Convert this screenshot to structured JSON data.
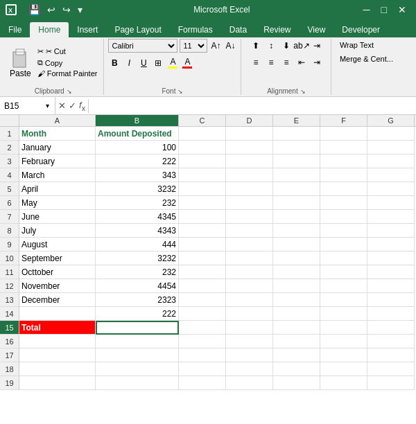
{
  "titleBar": {
    "title": "Microsoft Excel",
    "saveLabel": "💾",
    "undoLabel": "↩",
    "redoLabel": "↪"
  },
  "ribbonTabs": [
    "File",
    "Home",
    "Insert",
    "Page Layout",
    "Formulas",
    "Data",
    "Review",
    "View",
    "Developer"
  ],
  "activeTab": "Home",
  "clipboard": {
    "pasteLabel": "Paste",
    "cutLabel": "✂ Cut",
    "copyLabel": "📋 Copy",
    "formatPainterLabel": "🖌 Format Painter",
    "groupLabel": "Clipboard"
  },
  "font": {
    "name": "Calibri",
    "size": "11",
    "groupLabel": "Font",
    "boldLabel": "B",
    "italicLabel": "I",
    "underlineLabel": "U",
    "fillColor": "#FFFF00",
    "fontColor": "#FF0000"
  },
  "alignment": {
    "groupLabel": "Alignment",
    "wrapText": "Wrap Text",
    "mergeCenterLabel": "Merge & Cent..."
  },
  "formulaBar": {
    "nameBox": "B15",
    "formula": ""
  },
  "columns": [
    "A",
    "B",
    "C",
    "D",
    "E",
    "F",
    "G"
  ],
  "rows": [
    {
      "num": 1,
      "a": "Month",
      "b": "Amount Deposited",
      "isHeader": true
    },
    {
      "num": 2,
      "a": "January",
      "b": "100"
    },
    {
      "num": 3,
      "a": "February",
      "b": "222"
    },
    {
      "num": 4,
      "a": "March",
      "b": "343"
    },
    {
      "num": 5,
      "a": "April",
      "b": "3232"
    },
    {
      "num": 6,
      "a": "May",
      "b": "232"
    },
    {
      "num": 7,
      "a": "June",
      "b": "4345"
    },
    {
      "num": 8,
      "a": "July",
      "b": "4343"
    },
    {
      "num": 9,
      "a": "August",
      "b": "444"
    },
    {
      "num": 10,
      "a": "September",
      "b": "3232"
    },
    {
      "num": 11,
      "a": "Octtober",
      "b": "232"
    },
    {
      "num": 12,
      "a": "November",
      "b": "4454"
    },
    {
      "num": 13,
      "a": "December",
      "b": "2323"
    },
    {
      "num": 14,
      "a": "",
      "b": "222"
    },
    {
      "num": 15,
      "a": "Total",
      "b": "",
      "isTotal": true
    },
    {
      "num": 16,
      "a": "",
      "b": ""
    },
    {
      "num": 17,
      "a": "",
      "b": ""
    },
    {
      "num": 18,
      "a": "",
      "b": ""
    },
    {
      "num": 19,
      "a": "",
      "b": ""
    }
  ]
}
